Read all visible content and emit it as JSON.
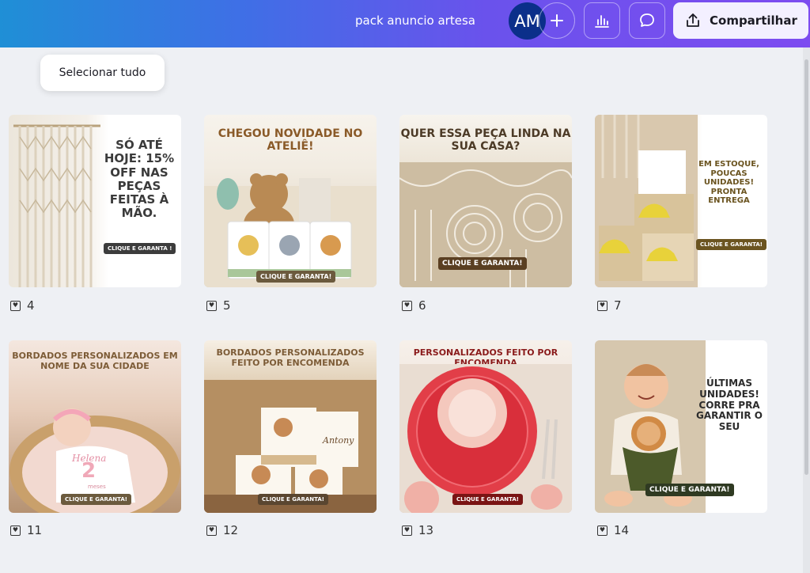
{
  "header": {
    "doc_title": "pack anuncio artesa",
    "avatar_initials": "AM",
    "share_label": "Compartilhar",
    "gradient": [
      "#1f8fd6",
      "#7d4cf0"
    ]
  },
  "toolbar": {
    "select_all_label": "Selecionar tudo"
  },
  "pages": [
    {
      "number": "4",
      "headline": "SÓ ATÉ HOJE: 15% OFF NAS PEÇAS FEITAS À MÃO.",
      "cta": "CLIQUE E GARANTA !"
    },
    {
      "number": "5",
      "headline": "CHEGOU NOVIDADE NO ATELIÊ!",
      "cta": "CLIQUE E GARANTA!"
    },
    {
      "number": "6",
      "headline": "QUER ESSA PEÇA LINDA NA SUA CASA?",
      "cta": "CLIQUE E GARANTA!"
    },
    {
      "number": "7",
      "headline": "EM ESTOQUE, POUCAS UNIDADES! PRONTA ENTREGA",
      "cta": "CLIQUE E GARANTA!"
    },
    {
      "number": "11",
      "headline": "BORDADOS PERSONALIZADOS EM NOME DA SUA CIDADE",
      "cta": "CLIQUE E GARANTA!",
      "bib_name": "Helena",
      "bib_age": "2",
      "bib_unit": "meses"
    },
    {
      "number": "12",
      "headline": "BORDADOS PERSONALIZADOS FEITO POR ENCOMENDA",
      "cta": "CLIQUE E GARANTA!",
      "towel_name": "Antony"
    },
    {
      "number": "13",
      "headline": "PERSONALIZADOS FEITO POR ENCOMENDA",
      "cta": "CLIQUE E GARANTA!"
    },
    {
      "number": "14",
      "headline": "ÚLTIMAS UNIDADES! CORRE PRA GARANTIR O SEU",
      "cta": "CLIQUE E GARANTA!"
    }
  ]
}
